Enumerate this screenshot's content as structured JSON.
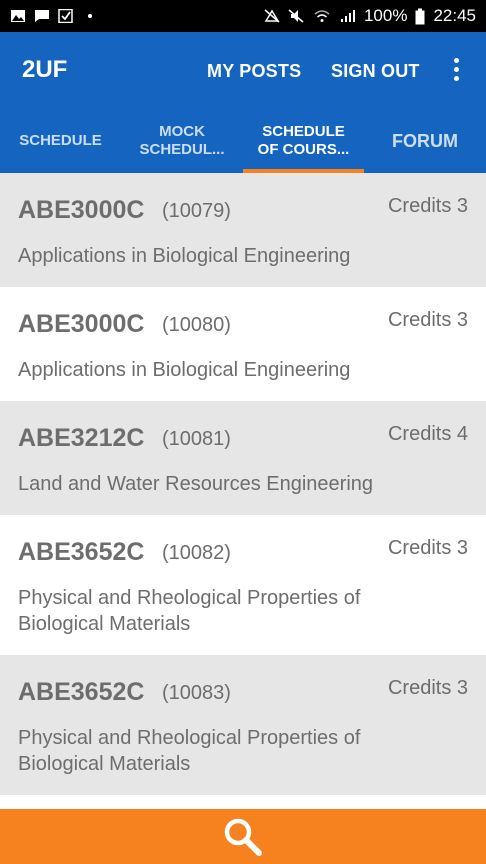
{
  "status_bar": {
    "battery_percent": "100%",
    "time": "22:45",
    "icons": [
      "image-icon",
      "message-icon",
      "checkbox-icon",
      "dot-icon",
      "sync-off-icon",
      "mute-icon",
      "wifi-icon",
      "signal-icon",
      "battery-icon"
    ]
  },
  "app_bar": {
    "title": "2UF",
    "actions": [
      "MY POSTS",
      "SIGN OUT"
    ],
    "overflow_icon": "more-vertical-icon",
    "color": "#1565c0"
  },
  "tabs": [
    {
      "label": "SCHEDULE",
      "active": false
    },
    {
      "label": "MOCK SCHEDUL...",
      "line1": "MOCK",
      "line2": "SCHEDUL...",
      "active": false
    },
    {
      "label": "SCHEDULE OF COURS...",
      "line1": "SCHEDULE",
      "line2": "OF COURS...",
      "active": true
    },
    {
      "label": "FORUM",
      "active": false
    }
  ],
  "accent_color": "#f5821f",
  "courses": [
    {
      "code": "ABE3000C",
      "id": "(10079)",
      "credits": "Credits 3",
      "name": "Applications in Biological Engineering"
    },
    {
      "code": "ABE3000C",
      "id": "(10080)",
      "credits": "Credits 3",
      "name": "Applications in Biological Engineering"
    },
    {
      "code": "ABE3212C",
      "id": "(10081)",
      "credits": "Credits 4",
      "name": "Land and Water Resources Engineering"
    },
    {
      "code": "ABE3652C",
      "id": "(10082)",
      "credits": "Credits 3",
      "name": "Physical and Rheological Properties of Biological Materials"
    },
    {
      "code": "ABE3652C",
      "id": "(10083)",
      "credits": "Credits 3",
      "name": "Physical and Rheological Properties of Biological Materials"
    }
  ],
  "bottom_bar": {
    "icon": "search-icon"
  }
}
